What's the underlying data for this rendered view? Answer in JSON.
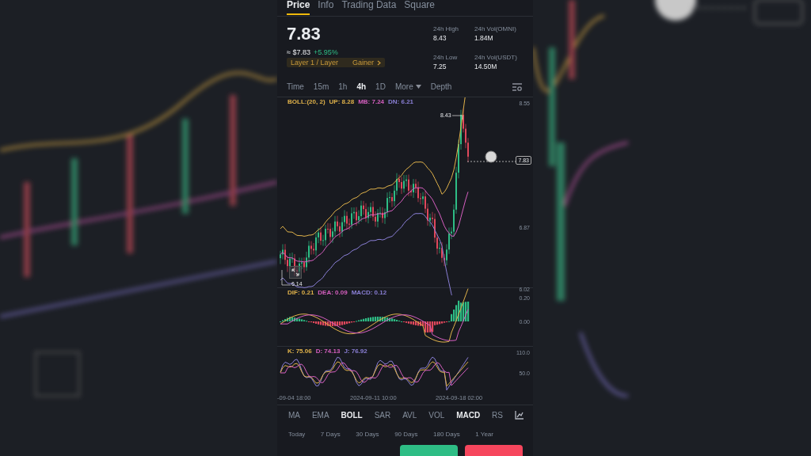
{
  "tabs": [
    {
      "label": "Price",
      "selected": true
    },
    {
      "label": "Info",
      "selected": false
    },
    {
      "label": "Trading Data",
      "selected": false
    },
    {
      "label": "Square",
      "selected": false
    }
  ],
  "price": {
    "last": "7.83",
    "fiat": "≈ $7.83",
    "change": "+5.95%",
    "tags": [
      "Layer 1 / Layer",
      "Gainer"
    ]
  },
  "stats": [
    {
      "label": "24h High",
      "value": "8.43"
    },
    {
      "label": "24h Vol(OMNI)",
      "value": "1.84M"
    },
    {
      "label": "24h Low",
      "value": "7.25"
    },
    {
      "label": "24h Vol(USDT)",
      "value": "14.50M"
    }
  ],
  "intervals": [
    {
      "label": "Time",
      "selected": false
    },
    {
      "label": "15m",
      "selected": false
    },
    {
      "label": "1h",
      "selected": false
    },
    {
      "label": "4h",
      "selected": true
    },
    {
      "label": "1D",
      "selected": false
    },
    {
      "label": "More",
      "selected": false,
      "kind": "dropdown"
    },
    {
      "label": "Depth",
      "selected": false
    }
  ],
  "main_chart": {
    "legend": [
      {
        "text": "BOLL:(20, 2)",
        "color": "#e0b24a"
      },
      {
        "text": "UP: 8.28",
        "color": "#e0b24a"
      },
      {
        "text": "MB: 7.24",
        "color": "#d65fc0"
      },
      {
        "text": "DN: 6.21",
        "color": "#8a7fd6"
      }
    ],
    "axis": [
      "8.55",
      "6.87",
      "6.02"
    ],
    "current": "7.83",
    "high_label": "8.43",
    "low_label": "6.14"
  },
  "macd": {
    "legend": [
      {
        "text": "DIF: 0.21",
        "color": "#e0b24a"
      },
      {
        "text": "DEA: 0.09",
        "color": "#d65fc0"
      },
      {
        "text": "MACD: 0.12",
        "color": "#8a7fd6"
      }
    ],
    "axis": [
      "0.20",
      "0.00"
    ]
  },
  "kdj": {
    "legend": [
      {
        "text": "K: 75.06",
        "color": "#e0b24a"
      },
      {
        "text": "D: 74.13",
        "color": "#d65fc0"
      },
      {
        "text": "J: 76.92",
        "color": "#8a7fd6"
      }
    ],
    "axis": [
      "110.0",
      "50.0"
    ]
  },
  "dates": [
    "-09-04 18:00",
    "2024-09-11 10:00",
    "2024-09-18 02:00"
  ],
  "indicators": [
    {
      "label": "MA",
      "selected": false
    },
    {
      "label": "EMA",
      "selected": false
    },
    {
      "label": "BOLL",
      "selected": true
    },
    {
      "label": "SAR",
      "selected": false
    },
    {
      "label": "AVL",
      "selected": false
    },
    {
      "label": "VOL",
      "selected": false
    },
    {
      "label": "MACD",
      "selected": true
    },
    {
      "label": "RS",
      "selected": false
    }
  ],
  "ranges": [
    {
      "label": "Today",
      "selected": false
    },
    {
      "label": "7 Days",
      "selected": false
    },
    {
      "label": "30 Days",
      "selected": false
    },
    {
      "label": "90 Days",
      "selected": false
    },
    {
      "label": "180 Days",
      "selected": false
    },
    {
      "label": "1 Year",
      "selected": false
    }
  ]
}
